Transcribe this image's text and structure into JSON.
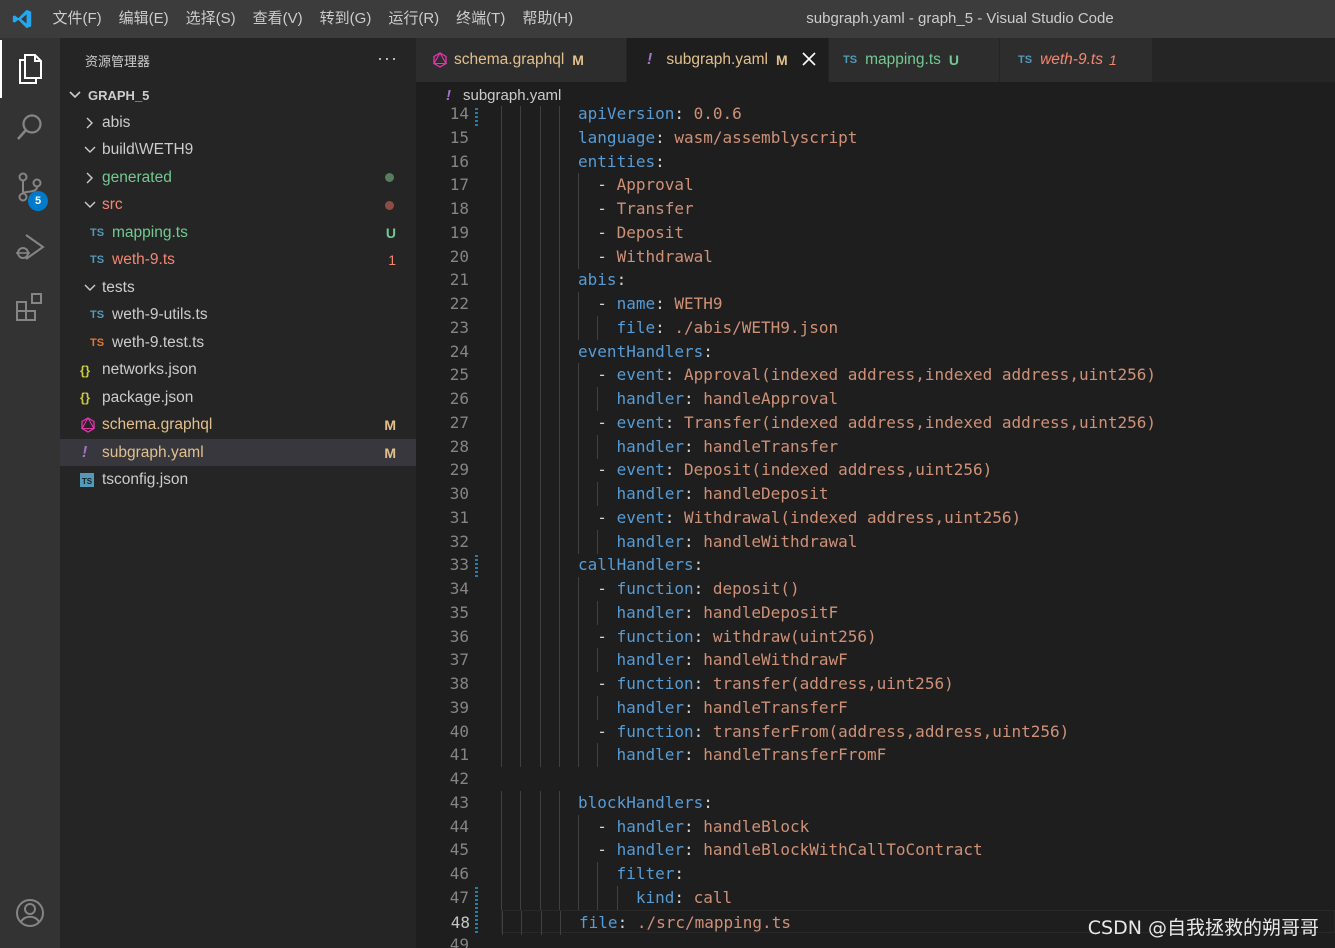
{
  "titlebar": {
    "menu": [
      "文件(F)",
      "编辑(E)",
      "选择(S)",
      "查看(V)",
      "转到(G)",
      "运行(R)",
      "终端(T)",
      "帮助(H)"
    ],
    "window_title": "subgraph.yaml - graph_5 - Visual Studio Code"
  },
  "activitybar": {
    "items": [
      "explorer-icon",
      "search-icon",
      "source-control-icon",
      "run-debug-icon",
      "extensions-icon",
      "account-icon"
    ],
    "source_control_badge": "5"
  },
  "sidebar": {
    "header": "资源管理器",
    "more": "···",
    "folder": "GRAPH_5",
    "tree": [
      {
        "name": "abis",
        "kind": "folder",
        "open": false,
        "depth": 1,
        "color": "#cccccc",
        "status": ""
      },
      {
        "name": "build\\WETH9",
        "kind": "folder",
        "open": true,
        "depth": 1,
        "color": "#cccccc",
        "status": ""
      },
      {
        "name": "generated",
        "kind": "folder",
        "open": false,
        "depth": 1,
        "color": "#73c991",
        "status": "dot-green"
      },
      {
        "name": "src",
        "kind": "folder",
        "open": true,
        "depth": 1,
        "color": "#f48771",
        "status": "dot-red"
      },
      {
        "name": "mapping.ts",
        "kind": "ts",
        "depth": 2,
        "color": "#73c991",
        "status": "U"
      },
      {
        "name": "weth-9.ts",
        "kind": "ts",
        "depth": 2,
        "color": "#f48771",
        "status": "1"
      },
      {
        "name": "tests",
        "kind": "folder",
        "open": true,
        "depth": 1,
        "color": "#cccccc",
        "status": ""
      },
      {
        "name": "weth-9-utils.ts",
        "kind": "ts",
        "depth": 2,
        "color": "#cccccc",
        "status": ""
      },
      {
        "name": "weth-9.test.ts",
        "kind": "ts-test",
        "depth": 2,
        "color": "#cccccc",
        "status": ""
      },
      {
        "name": "networks.json",
        "kind": "json",
        "depth": 1,
        "color": "#cccccc",
        "status": ""
      },
      {
        "name": "package.json",
        "kind": "json",
        "depth": 1,
        "color": "#cccccc",
        "status": ""
      },
      {
        "name": "schema.graphql",
        "kind": "graphql",
        "depth": 1,
        "color": "#e2c08d",
        "status": "M"
      },
      {
        "name": "subgraph.yaml",
        "kind": "yaml",
        "depth": 1,
        "color": "#e2c08d",
        "status": "M",
        "selected": true
      },
      {
        "name": "tsconfig.json",
        "kind": "tsconfig",
        "depth": 1,
        "color": "#cccccc",
        "status": ""
      }
    ]
  },
  "tabs": [
    {
      "label": "schema.graphql",
      "icon": "graphql-icon",
      "status": "M",
      "color": "#e2c08d",
      "active": false
    },
    {
      "label": "subgraph.yaml",
      "icon": "yaml-icon",
      "status": "M",
      "color": "#e2c08d",
      "active": true
    },
    {
      "label": "mapping.ts",
      "icon": "ts-icon",
      "status": "U",
      "color": "#73c991",
      "active": false
    },
    {
      "label": "weth-9.ts",
      "icon": "ts-icon",
      "status": "1",
      "color": "#f48771",
      "active": false
    }
  ],
  "breadcrumb": {
    "icon": "!",
    "file": "subgraph.yaml"
  },
  "editor": {
    "current_line": "48",
    "lines": [
      {
        "n": "14",
        "i": 4,
        "t": [
          [
            "k",
            "apiVersion"
          ],
          [
            "p",
            ": "
          ],
          [
            "v",
            "0.0.6"
          ]
        ]
      },
      {
        "n": "15",
        "i": 4,
        "t": [
          [
            "k",
            "language"
          ],
          [
            "p",
            ": "
          ],
          [
            "v",
            "wasm/assemblyscript"
          ]
        ]
      },
      {
        "n": "16",
        "i": 4,
        "t": [
          [
            "k",
            "entities"
          ],
          [
            "p",
            ":"
          ]
        ]
      },
      {
        "n": "17",
        "i": 5,
        "t": [
          [
            "p",
            "- "
          ],
          [
            "v",
            "Approval"
          ]
        ]
      },
      {
        "n": "18",
        "i": 5,
        "t": [
          [
            "p",
            "- "
          ],
          [
            "v",
            "Transfer"
          ]
        ]
      },
      {
        "n": "19",
        "i": 5,
        "t": [
          [
            "p",
            "- "
          ],
          [
            "v",
            "Deposit"
          ]
        ]
      },
      {
        "n": "20",
        "i": 5,
        "t": [
          [
            "p",
            "- "
          ],
          [
            "v",
            "Withdrawal"
          ]
        ]
      },
      {
        "n": "21",
        "i": 4,
        "t": [
          [
            "k",
            "abis"
          ],
          [
            "p",
            ":"
          ]
        ]
      },
      {
        "n": "22",
        "i": 5,
        "t": [
          [
            "p",
            "- "
          ],
          [
            "k",
            "name"
          ],
          [
            "p",
            ": "
          ],
          [
            "v",
            "WETH9"
          ]
        ]
      },
      {
        "n": "23",
        "i": 6,
        "t": [
          [
            "k",
            "file"
          ],
          [
            "p",
            ": "
          ],
          [
            "v",
            "./abis/WETH9.json"
          ]
        ]
      },
      {
        "n": "24",
        "i": 4,
        "t": [
          [
            "k",
            "eventHandlers"
          ],
          [
            "p",
            ":"
          ]
        ]
      },
      {
        "n": "25",
        "i": 5,
        "t": [
          [
            "p",
            "- "
          ],
          [
            "k",
            "event"
          ],
          [
            "p",
            ": "
          ],
          [
            "v",
            "Approval(indexed address,indexed address,uint256)"
          ]
        ]
      },
      {
        "n": "26",
        "i": 6,
        "t": [
          [
            "k",
            "handler"
          ],
          [
            "p",
            ": "
          ],
          [
            "v",
            "handleApproval"
          ]
        ]
      },
      {
        "n": "27",
        "i": 5,
        "t": [
          [
            "p",
            "- "
          ],
          [
            "k",
            "event"
          ],
          [
            "p",
            ": "
          ],
          [
            "v",
            "Transfer(indexed address,indexed address,uint256)"
          ]
        ]
      },
      {
        "n": "28",
        "i": 6,
        "t": [
          [
            "k",
            "handler"
          ],
          [
            "p",
            ": "
          ],
          [
            "v",
            "handleTransfer"
          ]
        ]
      },
      {
        "n": "29",
        "i": 5,
        "t": [
          [
            "p",
            "- "
          ],
          [
            "k",
            "event"
          ],
          [
            "p",
            ": "
          ],
          [
            "v",
            "Deposit(indexed address,uint256)"
          ]
        ]
      },
      {
        "n": "30",
        "i": 6,
        "t": [
          [
            "k",
            "handler"
          ],
          [
            "p",
            ": "
          ],
          [
            "v",
            "handleDeposit"
          ]
        ]
      },
      {
        "n": "31",
        "i": 5,
        "t": [
          [
            "p",
            "- "
          ],
          [
            "k",
            "event"
          ],
          [
            "p",
            ": "
          ],
          [
            "v",
            "Withdrawal(indexed address,uint256)"
          ]
        ]
      },
      {
        "n": "32",
        "i": 6,
        "t": [
          [
            "k",
            "handler"
          ],
          [
            "p",
            ": "
          ],
          [
            "v",
            "handleWithdrawal"
          ]
        ]
      },
      {
        "n": "33",
        "i": 4,
        "t": [
          [
            "k",
            "callHandlers"
          ],
          [
            "p",
            ":"
          ]
        ]
      },
      {
        "n": "34",
        "i": 5,
        "t": [
          [
            "p",
            "- "
          ],
          [
            "k",
            "function"
          ],
          [
            "p",
            ": "
          ],
          [
            "v",
            "deposit()"
          ]
        ]
      },
      {
        "n": "35",
        "i": 6,
        "t": [
          [
            "k",
            "handler"
          ],
          [
            "p",
            ": "
          ],
          [
            "v",
            "handleDepositF"
          ]
        ]
      },
      {
        "n": "36",
        "i": 5,
        "t": [
          [
            "p",
            "- "
          ],
          [
            "k",
            "function"
          ],
          [
            "p",
            ": "
          ],
          [
            "v",
            "withdraw(uint256)"
          ]
        ]
      },
      {
        "n": "37",
        "i": 6,
        "t": [
          [
            "k",
            "handler"
          ],
          [
            "p",
            ": "
          ],
          [
            "v",
            "handleWithdrawF"
          ]
        ]
      },
      {
        "n": "38",
        "i": 5,
        "t": [
          [
            "p",
            "- "
          ],
          [
            "k",
            "function"
          ],
          [
            "p",
            ": "
          ],
          [
            "v",
            "transfer(address,uint256)"
          ]
        ]
      },
      {
        "n": "39",
        "i": 6,
        "t": [
          [
            "k",
            "handler"
          ],
          [
            "p",
            ": "
          ],
          [
            "v",
            "handleTransferF"
          ]
        ]
      },
      {
        "n": "40",
        "i": 5,
        "t": [
          [
            "p",
            "- "
          ],
          [
            "k",
            "function"
          ],
          [
            "p",
            ": "
          ],
          [
            "v",
            "transferFrom(address,address,uint256)"
          ]
        ]
      },
      {
        "n": "41",
        "i": 6,
        "t": [
          [
            "k",
            "handler"
          ],
          [
            "p",
            ": "
          ],
          [
            "v",
            "handleTransferFromF"
          ]
        ]
      },
      {
        "n": "42",
        "i": 0,
        "t": []
      },
      {
        "n": "43",
        "i": 4,
        "t": [
          [
            "k",
            "blockHandlers"
          ],
          [
            "p",
            ":"
          ]
        ]
      },
      {
        "n": "44",
        "i": 5,
        "t": [
          [
            "p",
            "- "
          ],
          [
            "k",
            "handler"
          ],
          [
            "p",
            ": "
          ],
          [
            "v",
            "handleBlock"
          ]
        ]
      },
      {
        "n": "45",
        "i": 5,
        "t": [
          [
            "p",
            "- "
          ],
          [
            "k",
            "handler"
          ],
          [
            "p",
            ": "
          ],
          [
            "v",
            "handleBlockWithCallToContract"
          ]
        ]
      },
      {
        "n": "46",
        "i": 6,
        "t": [
          [
            "k",
            "filter"
          ],
          [
            "p",
            ":"
          ]
        ]
      },
      {
        "n": "47",
        "i": 7,
        "t": [
          [
            "k",
            "kind"
          ],
          [
            "p",
            ": "
          ],
          [
            "v",
            "call"
          ]
        ]
      },
      {
        "n": "48",
        "i": 4,
        "t": [
          [
            "k",
            "file"
          ],
          [
            "p",
            ": "
          ],
          [
            "v",
            "./src/mapping.ts"
          ]
        ]
      },
      {
        "n": "49",
        "i": 0,
        "t": []
      }
    ]
  },
  "watermark": "CSDN @自我拯救的朔哥哥",
  "colors": {
    "accent": "#007acc",
    "keyword": "#569cd6",
    "string": "#ce9178",
    "modified": "#e2c08d",
    "untracked": "#73c991",
    "error": "#f48771"
  }
}
